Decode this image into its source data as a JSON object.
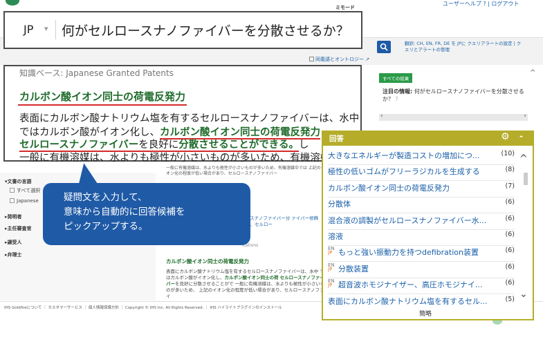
{
  "topbar": {
    "mode_label": "ミモード",
    "user_links": "ユーザーヘルプ ? | ログアウト"
  },
  "question": {
    "lang": "JP",
    "text": "何がセルロースナノファイバーを分散させるか？"
  },
  "search_options": {
    "thesaurus_label": "同義語とオントロジー",
    "translation_info": "翻訳: CH, EN, FR, DE を JPに クエリアラートの設定 | クエリとアラートの管理"
  },
  "knowledge_base": {
    "source_label": "知識ベース:  Japanese Granted Patents",
    "title": "カルボン酸イオン同士の荷電反発力",
    "line1": "表面にカルボン酸ナトリウム塩を有するセルロースナノファイバーは、水中",
    "line2_a": "ではカルボン酸がイオン化し、",
    "line2_b": "カルボン酸イオン同士の荷電反発力",
    "line3_a": "セルロースナノファイバー",
    "line3_b": "を良好に",
    "line3_c": "分散させることができる。",
    "line3_d": "し",
    "line4": "一般に有機溶媒は、水よりも極性が小さいものが多いため、有機溶媒"
  },
  "callout": {
    "line1": "疑問文を入力して、",
    "line2": "意味から自動的に回答候補を",
    "line3": "ピックアップする。"
  },
  "right_panel": {
    "all_results": "すべての結果",
    "attention_label": "注目の情報:",
    "attention_text": "何がセルロースナノファイバーを分散させるか？"
  },
  "sidebar": {
    "lang_heading": "▾文書の言語",
    "lang_all": "すべて選択",
    "lang_jp": "Japanese",
    "inventor": "▸発明者",
    "assignee": "▸主任審査官",
    "attorney": "▸譲受人",
    "patent_attorney": "▸弁理士"
  },
  "background_results": {
    "text1": "一般に有機溶媒は、水よりも極性が小さいものが多いため、有機溶媒中では 上記のイオン化の程度が低い場合があり、セルロースナノファイバー",
    "text2": "ースナノファイバー分 ァイバー修飾体、セルロー",
    "text3": "ications",
    "title2": "カルボン酸イオン同士の荷電反発力",
    "text4_a": "表面にカルボン酸ナトリウム塩を有するセルロースナノファイバーは、水中 ではカルボン酸がイオン化し、",
    "text4_b": "カルボン酸イオン同士の荷",
    "text4_c": "セルロースナノファイバー",
    "text4_d": "を良好に分散させることがで 一般に有機溶媒は、水よりも極性が小さいものが多いため、 上記のイオン化の程度が低い場合があり、セルロースナノファイ"
  },
  "footer": {
    "text": "IHS Goldfireについて ｜ カスタマーサービス ｜ 個人情報保護方針 ｜ Copyright © IHS Inc. All Rights Reserved. ｜ IHS ハイライトプラグインのインストール"
  },
  "answers": {
    "title": "回答",
    "collapse": "-",
    "footer": "簡略",
    "items": [
      {
        "label": "大きなエネルギーが製造コストの増加につ...",
        "count": "(10)",
        "en_jp": false
      },
      {
        "label": "極性の低いゴムがフリーラジカルを生成する",
        "count": "(8)",
        "en_jp": false
      },
      {
        "label": "カルボン酸イオン同士の荷電反発力",
        "count": "(7)",
        "en_jp": false
      },
      {
        "label": "分散体",
        "count": "(6)",
        "en_jp": false
      },
      {
        "label": "混合液の調製がセルロースナノファイバー水...",
        "count": "(6)",
        "en_jp": false
      },
      {
        "label": "溶液",
        "count": "(6)",
        "en_jp": false
      },
      {
        "label": "もっと強い振動力を持つdefibration装置",
        "count": "(6)",
        "en_jp": true
      },
      {
        "label": "分散装置",
        "count": "(6)",
        "en_jp": true
      },
      {
        "label": "超音波ホモジナイザー、高圧ホモジナイ...",
        "count": "(6)",
        "en_jp": true
      },
      {
        "label": "表面にカルボン酸ナトリウム塩を有するセル...",
        "count": "(5)",
        "en_jp": false
      }
    ]
  },
  "badge_text": {
    "en": "EN",
    "jp": "JP"
  },
  "colors": {
    "accent_blue": "#1f5aa6",
    "answer_panel": "#b5ad2a",
    "highlight_green": "#1e6b2a",
    "underline_red": "#d42a2a"
  }
}
